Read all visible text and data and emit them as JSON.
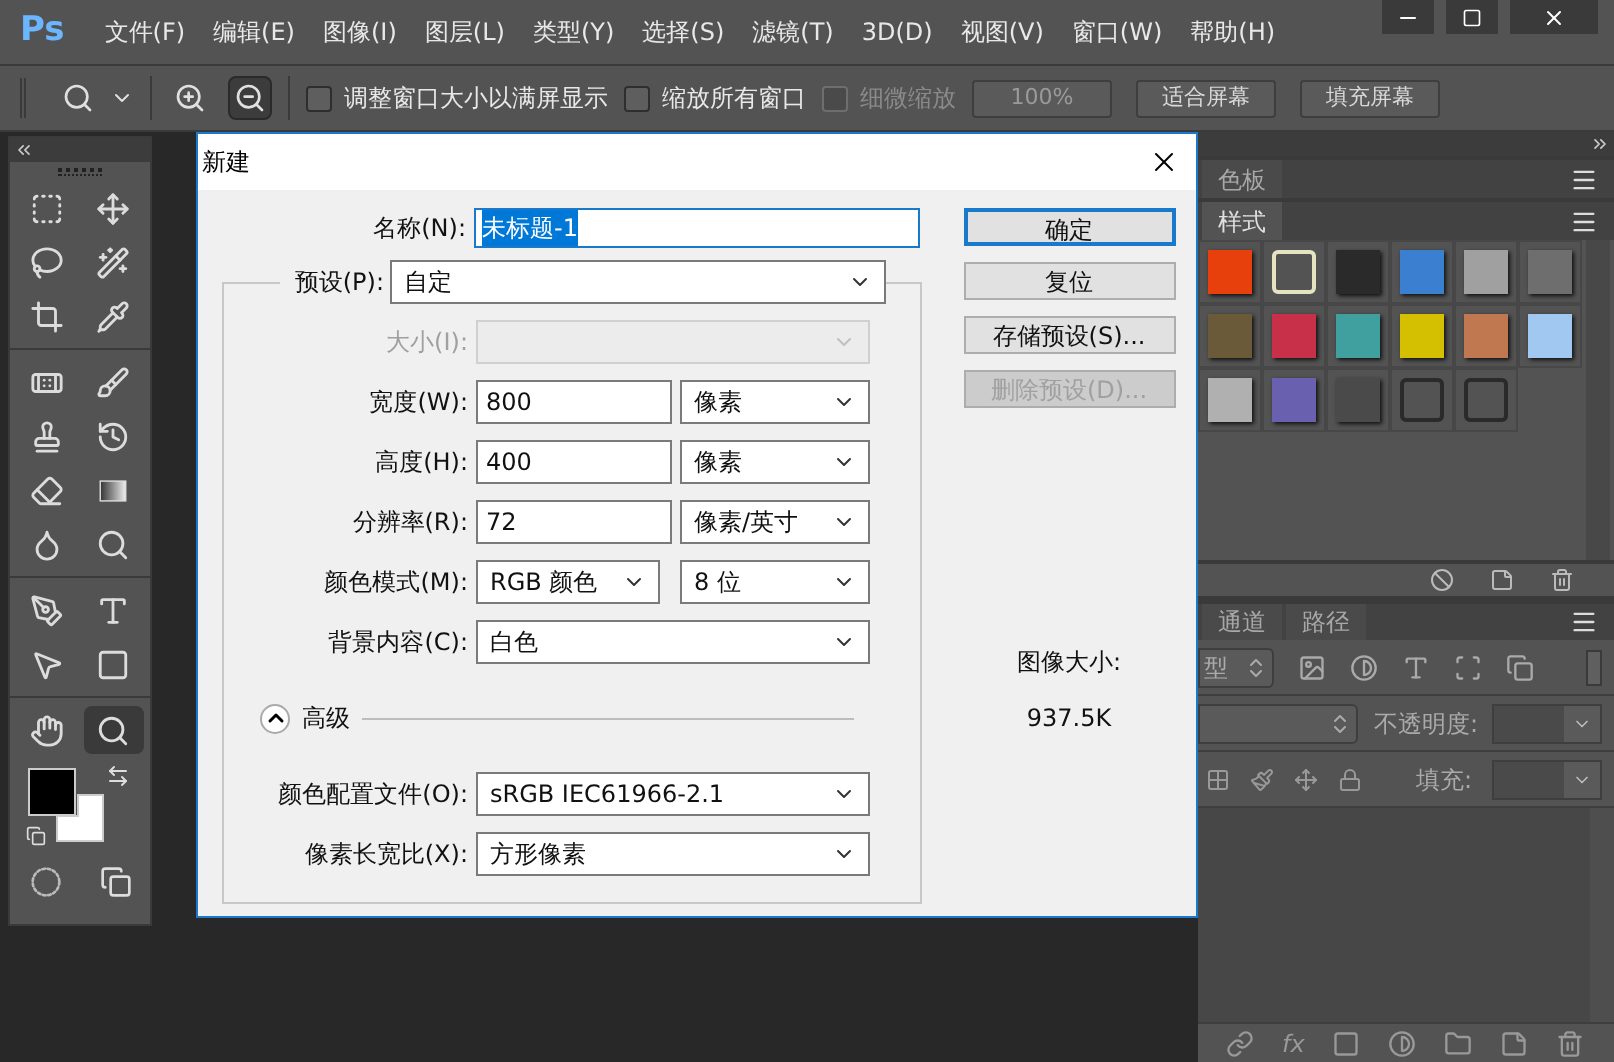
{
  "app": {
    "logo": "Ps",
    "menu": [
      "文件(F)",
      "编辑(E)",
      "图像(I)",
      "图层(L)",
      "类型(Y)",
      "选择(S)",
      "滤镜(T)",
      "3D(D)",
      "视图(V)",
      "窗口(W)",
      "帮助(H)"
    ]
  },
  "options_bar": {
    "zoom_modes": [
      {
        "selected": false
      },
      {
        "selected": true
      }
    ],
    "checkboxes": [
      {
        "label": "调整窗口大小以满屏显示",
        "checked": false,
        "disabled": false
      },
      {
        "label": "缩放所有窗口",
        "checked": false,
        "disabled": false
      },
      {
        "label": "细微缩放",
        "checked": false,
        "disabled": true
      }
    ],
    "buttons": [
      {
        "label": "100%",
        "disabled": true
      },
      {
        "label": "适合屏幕",
        "disabled": false
      },
      {
        "label": "填充屏幕",
        "disabled": false
      }
    ]
  },
  "toolbar": {
    "tools": [
      {
        "selected": false
      },
      {
        "selected": false
      },
      {
        "selected": false
      },
      {
        "selected": false
      },
      {
        "selected": false
      },
      {
        "selected": false
      },
      {
        "selected": false
      },
      {
        "selected": false
      },
      {
        "selected": false
      },
      {
        "selected": false
      },
      {
        "selected": false
      },
      {
        "selected": false
      },
      {
        "selected": false
      },
      {
        "selected": false
      },
      {
        "selected": false
      },
      {
        "selected": false
      },
      {
        "selected": false
      },
      {
        "selected": false
      },
      {
        "selected": false
      },
      {
        "selected": true
      }
    ],
    "color_swatches": [
      {
        "color": "#000000"
      },
      {
        "color": "#ffffff"
      }
    ]
  },
  "dialog": {
    "title": "新建",
    "name": {
      "label": "名称(N):",
      "value": "未标题-1",
      "selected": true
    },
    "preset": {
      "label": "预设(P):",
      "value": "自定"
    },
    "rows": [
      {
        "label": "大小(I):",
        "kind": "select",
        "disabled": true
      },
      {
        "label": "宽度(W):",
        "kind": "input_unit",
        "value": "800",
        "unit": "像素",
        "disabled": false
      },
      {
        "label": "高度(H):",
        "kind": "input_unit",
        "value": "400",
        "unit": "像素",
        "disabled": false
      },
      {
        "label": "分辨率(R):",
        "kind": "input_unit",
        "value": "72",
        "unit": "像素/英寸",
        "disabled": false
      },
      {
        "label": "颜色模式(M):",
        "kind": "select_pair",
        "value": "RGB 颜色",
        "unit": "8 位",
        "disabled": false
      },
      {
        "label": "背景内容(C):",
        "kind": "select",
        "value": "白色",
        "disabled": false
      }
    ],
    "advanced": {
      "label": "高级",
      "expanded": true
    },
    "advanced_rows": [
      {
        "label": "颜色配置文件(O):",
        "value": "sRGB IEC61966-2.1"
      },
      {
        "label": "像素长宽比(X):",
        "value": "方形像素"
      }
    ],
    "buttons": [
      {
        "label": "确定",
        "default": true,
        "disabled": false
      },
      {
        "label": "复位",
        "default": false,
        "disabled": false
      },
      {
        "label": "存储预设(S)...",
        "default": false,
        "disabled": false
      },
      {
        "label": "删除预设(D)...",
        "default": false,
        "disabled": true
      }
    ],
    "image_size": {
      "label": "图像大小:",
      "value": "937.5K"
    }
  },
  "panels": {
    "swatches_tabs": [
      {
        "label": "色板",
        "selected": false
      }
    ],
    "styles_tabs": [
      {
        "label": "样式",
        "selected": true
      }
    ],
    "styles": [
      {
        "kind": "fill",
        "color": "#e8400c"
      },
      {
        "kind": "frame",
        "color": "#e6e3c0"
      },
      {
        "kind": "fill",
        "color": "#2a2a2a"
      },
      {
        "kind": "fill",
        "color": "#3a7fd0"
      },
      {
        "kind": "fill",
        "color": "#a0a0a0"
      },
      {
        "kind": "fill",
        "color": "#6e6e6e"
      },
      {
        "kind": "fill",
        "color": "#6a5a3a"
      },
      {
        "kind": "fill",
        "color": "#c8304a"
      },
      {
        "kind": "fill",
        "color": "#40a0a0"
      },
      {
        "kind": "fill",
        "color": "#d4c000"
      },
      {
        "kind": "fill",
        "color": "#c07850"
      },
      {
        "kind": "fill",
        "color": "#a0c8f0"
      },
      {
        "kind": "fill",
        "color": "#b0b0b0"
      },
      {
        "kind": "fill",
        "color": "#6a60b0"
      },
      {
        "kind": "fill",
        "color": "#4a4a4a"
      },
      {
        "kind": "frame",
        "color": "#2a2a2a"
      },
      {
        "kind": "frame",
        "color": "#2a2a2a"
      }
    ],
    "layers_tabs": [
      {
        "label": "通道",
        "selected": false
      },
      {
        "label": "路径",
        "selected": false
      }
    ],
    "filter": "型",
    "opacity_label": "不透明度:",
    "fill_label": "填充:",
    "fx": "fx"
  }
}
